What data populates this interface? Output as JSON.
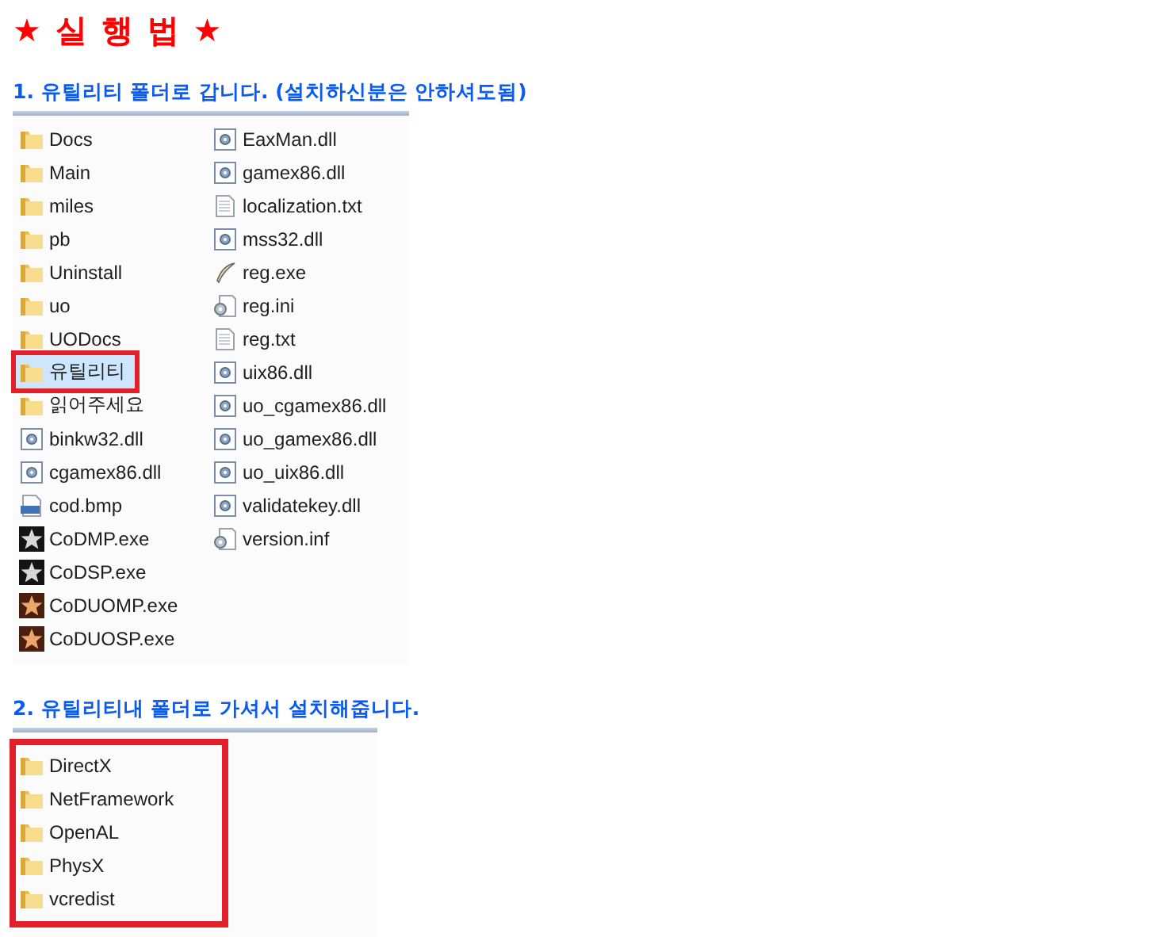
{
  "title": "★ 실 행 법 ★",
  "sections": [
    {
      "heading": "1. 유틸리티 폴더로 갑니다. (설치하신분은 안하셔도됨)",
      "boxed": false,
      "columns": [
        [
          {
            "name": "Docs",
            "kind": "folder",
            "highlighted": false
          },
          {
            "name": "Main",
            "kind": "folder",
            "highlighted": false
          },
          {
            "name": "miles",
            "kind": "folder",
            "highlighted": false
          },
          {
            "name": "pb",
            "kind": "folder",
            "highlighted": false
          },
          {
            "name": "Uninstall",
            "kind": "folder",
            "highlighted": false
          },
          {
            "name": "uo",
            "kind": "folder",
            "highlighted": false
          },
          {
            "name": "UODocs",
            "kind": "folder",
            "highlighted": false
          },
          {
            "name": "유틸리티",
            "kind": "folder",
            "highlighted": true
          },
          {
            "name": "읽어주세요",
            "kind": "folder",
            "highlighted": false
          },
          {
            "name": "binkw32.dll",
            "kind": "dll",
            "highlighted": false
          },
          {
            "name": "cgamex86.dll",
            "kind": "dll",
            "highlighted": false
          },
          {
            "name": "cod.bmp",
            "kind": "bmp",
            "highlighted": false
          },
          {
            "name": "CoDMP.exe",
            "kind": "game",
            "highlighted": false
          },
          {
            "name": "CoDSP.exe",
            "kind": "game",
            "highlighted": false
          },
          {
            "name": "CoDUOMP.exe",
            "kind": "game-alt",
            "highlighted": false
          },
          {
            "name": "CoDUOSP.exe",
            "kind": "game-alt",
            "highlighted": false
          }
        ],
        [
          {
            "name": "EaxMan.dll",
            "kind": "dll",
            "highlighted": false
          },
          {
            "name": "gamex86.dll",
            "kind": "dll",
            "highlighted": false
          },
          {
            "name": "localization.txt",
            "kind": "text",
            "highlighted": false
          },
          {
            "name": "mss32.dll",
            "kind": "dll",
            "highlighted": false
          },
          {
            "name": "reg.exe",
            "kind": "pen",
            "highlighted": false
          },
          {
            "name": "reg.ini",
            "kind": "settings",
            "highlighted": false
          },
          {
            "name": "reg.txt",
            "kind": "text",
            "highlighted": false
          },
          {
            "name": "uix86.dll",
            "kind": "dll",
            "highlighted": false
          },
          {
            "name": "uo_cgamex86.dll",
            "kind": "dll",
            "highlighted": false
          },
          {
            "name": "uo_gamex86.dll",
            "kind": "dll",
            "highlighted": false
          },
          {
            "name": "uo_uix86.dll",
            "kind": "dll",
            "highlighted": false
          },
          {
            "name": "validatekey.dll",
            "kind": "dll",
            "highlighted": false
          },
          {
            "name": "version.inf",
            "kind": "settings",
            "highlighted": false
          }
        ]
      ]
    },
    {
      "heading": "2. 유틸리티내 폴더로 가셔서 설치해줍니다.",
      "boxed": true,
      "columns": [
        [
          {
            "name": "DirectX",
            "kind": "folder",
            "highlighted": false
          },
          {
            "name": "NetFramework",
            "kind": "folder",
            "highlighted": false
          },
          {
            "name": "OpenAL",
            "kind": "folder",
            "highlighted": false
          },
          {
            "name": "PhysX",
            "kind": "folder",
            "highlighted": false
          },
          {
            "name": "vcredist",
            "kind": "folder",
            "highlighted": false
          }
        ]
      ]
    }
  ]
}
